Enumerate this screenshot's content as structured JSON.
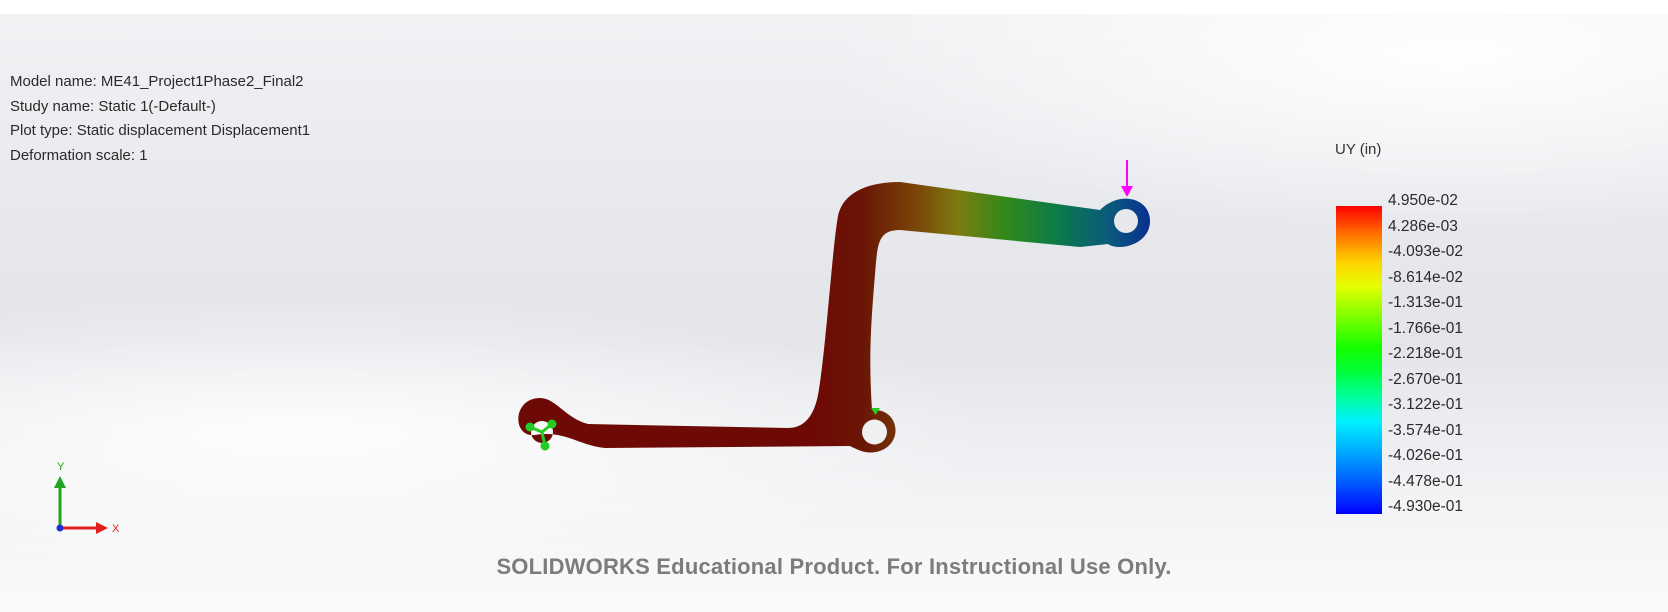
{
  "study_info": {
    "model_name": "Model name: ME41_Project1Phase2_Final2",
    "study_name": "Study name: Static 1(-Default-)",
    "plot_type": "Plot type: Static displacement Displacement1",
    "deformation_scale": "Deformation scale: 1"
  },
  "legend": {
    "title": "UY (in)",
    "labels": [
      "4.950e-02",
      "4.286e-03",
      "-4.093e-02",
      "-8.614e-02",
      "-1.313e-01",
      "-1.766e-01",
      "-2.218e-01",
      "-2.670e-01",
      "-3.122e-01",
      "-3.574e-01",
      "-4.026e-01",
      "-4.478e-01",
      "-4.930e-01"
    ],
    "colors": {
      "max": "#ff0000",
      "min": "#0000ff"
    }
  },
  "triad": {
    "x_label": "X",
    "y_label": "Y"
  },
  "watermark": "SOLIDWORKS Educational Product. For Instructional Use Only.",
  "part": {
    "load_marker_color": "#ff00ff",
    "fixture_marker_color": "#22cc22"
  }
}
